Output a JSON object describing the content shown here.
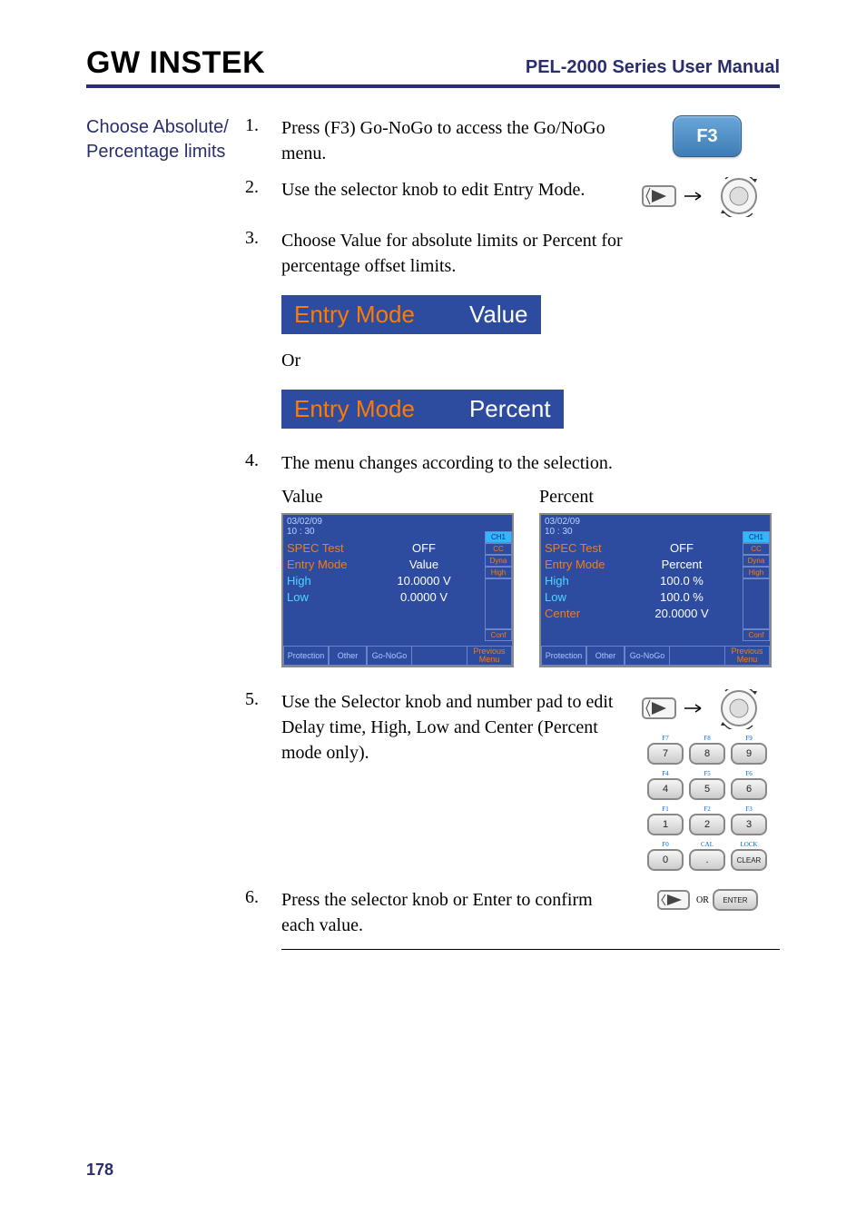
{
  "header": {
    "logo": "GW INSTEK",
    "manual_title": "PEL-2000 Series User Manual"
  },
  "section_label": "Choose Absolute/ Percentage limits",
  "steps": {
    "s1": {
      "num": "1.",
      "text": "Press (F3) Go-NoGo to access the Go/NoGo menu.",
      "key": "F3"
    },
    "s2": {
      "num": "2.",
      "text": "Use the selector knob to edit Entry Mode."
    },
    "s3": {
      "num": "3.",
      "text": "Choose Value for absolute limits or Percent for percentage offset limits."
    },
    "s4": {
      "num": "4.",
      "text": "The menu changes according to the selection."
    },
    "s5": {
      "num": "5.",
      "text": "Use the Selector knob and number pad to edit Delay time, High, Low and Center (Percent mode only)."
    },
    "s6": {
      "num": "6.",
      "text": "Press the selector knob or Enter to confirm each value."
    }
  },
  "entry_bar": {
    "label": "Entry Mode",
    "value1": "Value",
    "value2": "Percent"
  },
  "or_text": "Or",
  "screens_heading": {
    "value": "Value",
    "percent": "Percent"
  },
  "lcd_common": {
    "date": "03/02/09",
    "time": "10 : 30",
    "side_ch": "CH1",
    "side_cc": "CC",
    "side_dyna": "Dyna",
    "side_high": "High",
    "side_conf": "Conf",
    "fbtn_protection": "Protection",
    "fbtn_other": "Other",
    "fbtn_gonogo": "Go-NoGo",
    "fbtn_prev": "Previous Menu"
  },
  "lcd_value": {
    "rows": [
      {
        "k": "SPEC Test",
        "kc": "orange",
        "v": "OFF",
        "vc": "white"
      },
      {
        "k": "Entry Mode",
        "kc": "orange",
        "v": "Value",
        "vc": "white"
      },
      {
        "k": "High",
        "kc": "cyan",
        "v": "10.0000 V",
        "vc": "white"
      },
      {
        "k": "Low",
        "kc": "cyan",
        "v": "0.0000 V",
        "vc": "white"
      }
    ]
  },
  "lcd_percent": {
    "rows": [
      {
        "k": "SPEC Test",
        "kc": "orange",
        "v": "OFF",
        "vc": "white"
      },
      {
        "k": "Entry Mode",
        "kc": "orange",
        "v": "Percent",
        "vc": "white"
      },
      {
        "k": "High",
        "kc": "cyan",
        "v": "100.0 %",
        "vc": "white"
      },
      {
        "k": "Low",
        "kc": "cyan",
        "v": "100.0 %",
        "vc": "white"
      },
      {
        "k": "Center",
        "kc": "orange",
        "v": "20.0000 V",
        "vc": "white"
      }
    ]
  },
  "numpad": {
    "fcol": [
      "F7",
      "F8",
      "F9",
      "F4",
      "F5",
      "F6",
      "F1",
      "F2",
      "F3",
      "F0",
      "CAL",
      "LOCK"
    ],
    "keys": [
      "7",
      "8",
      "9",
      "4",
      "5",
      "6",
      "1",
      "2",
      "3",
      "0",
      ".",
      "CLEAR"
    ]
  },
  "enter": {
    "or": "OR",
    "label": "ENTER"
  },
  "page_number": "178"
}
